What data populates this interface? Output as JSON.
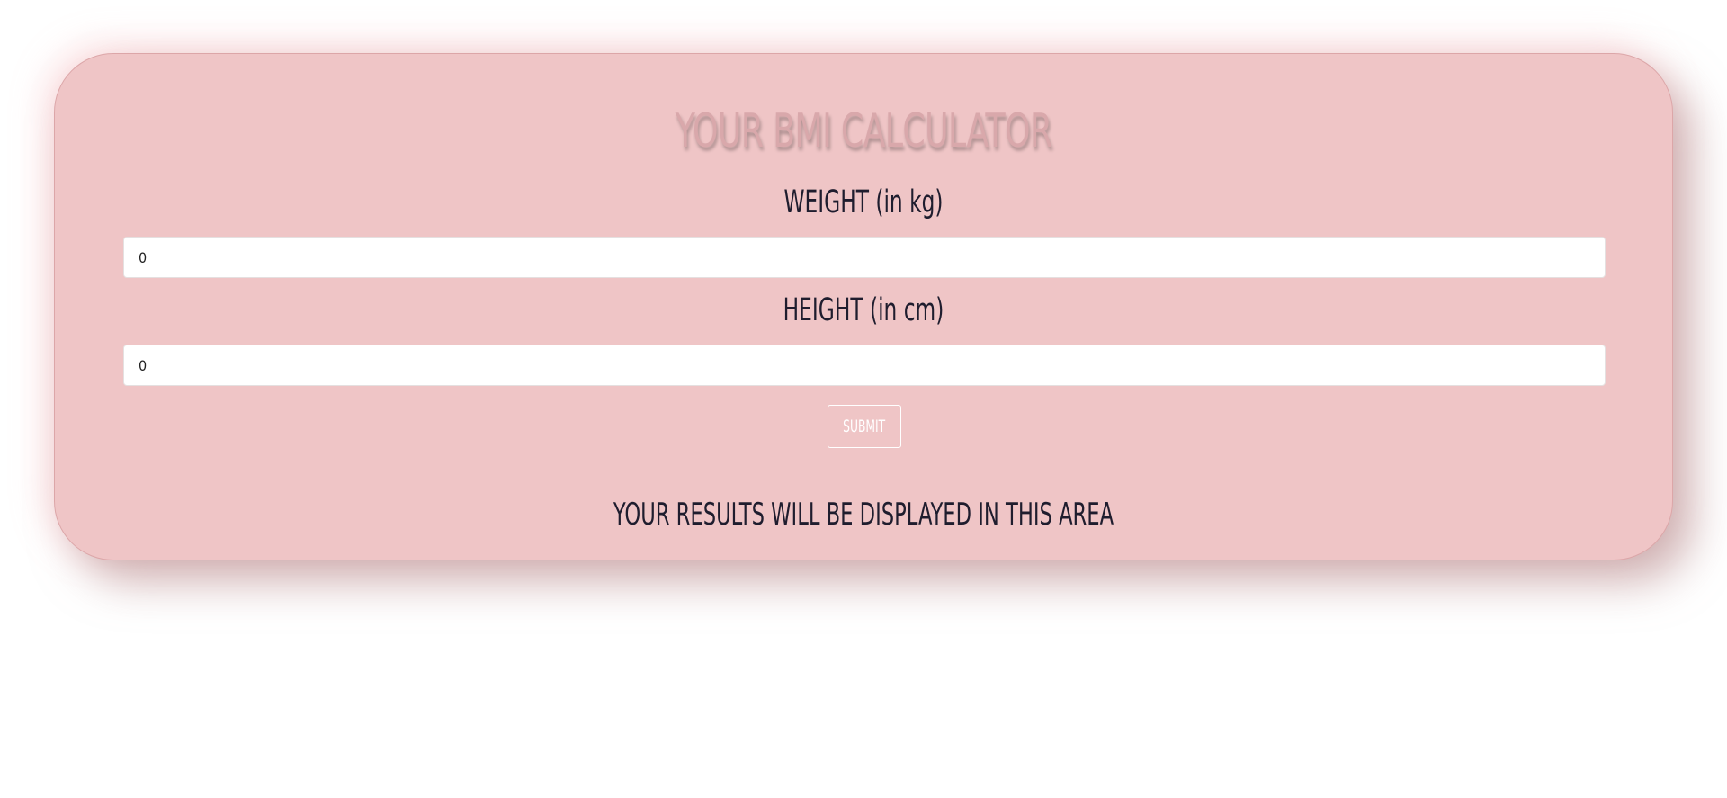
{
  "calculator": {
    "title": "YOUR BMI CALCULATOR",
    "weight": {
      "label": "WEIGHT (in kg)",
      "value": "0"
    },
    "height": {
      "label": "HEIGHT (in cm)",
      "value": "0"
    },
    "submit_label": "SUBMIT",
    "results_text": "YOUR RESULTS WILL BE DISPLAYED IN THIS AREA"
  },
  "colors": {
    "card_background": "#efc5c6",
    "title": "#d9a8ab",
    "label_text": "#1f1d2e",
    "button_text": "#ffffff"
  }
}
